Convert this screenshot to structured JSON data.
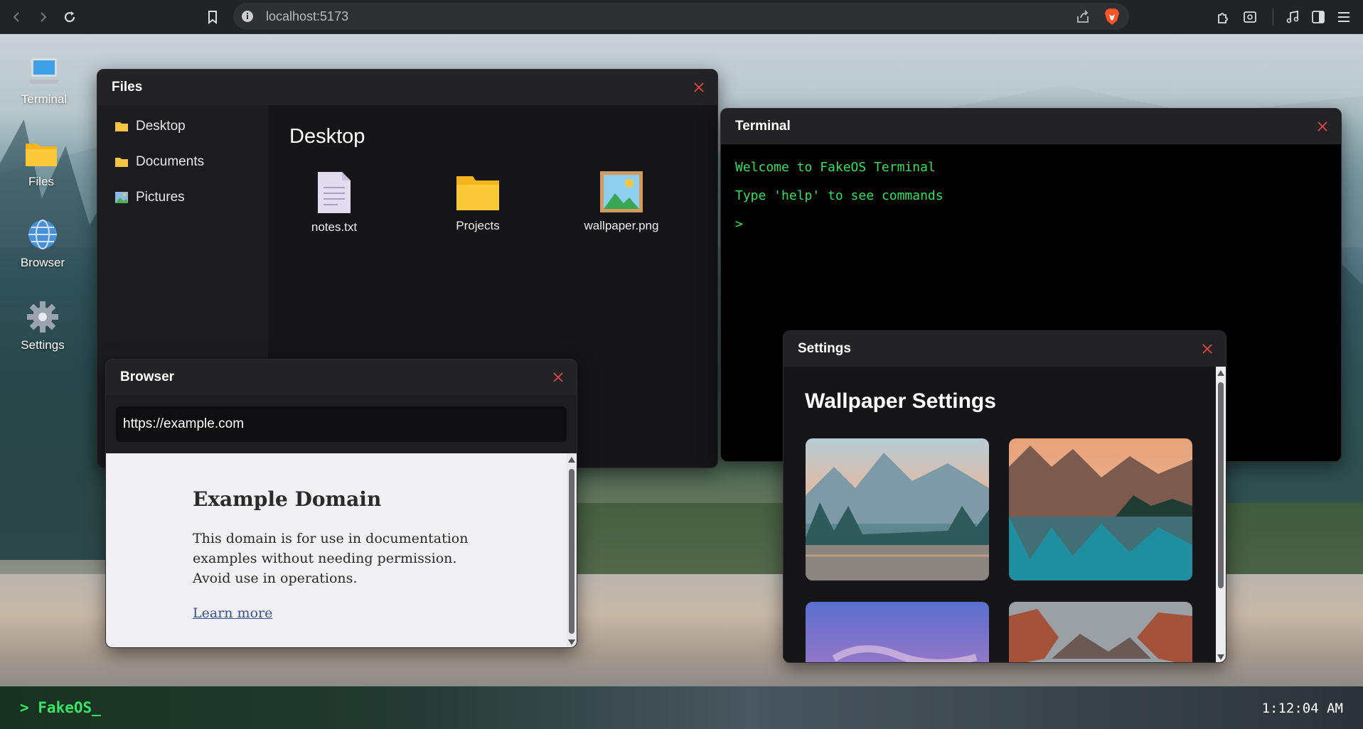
{
  "browser_chrome": {
    "url": "localhost:5173",
    "icons": [
      "back-icon",
      "forward-icon",
      "reload-icon",
      "bookmark-icon",
      "info-icon",
      "share-icon",
      "brave-icon",
      "extensions-icon",
      "screenshot-icon",
      "media-icon",
      "sidebar-icon",
      "menu-icon"
    ]
  },
  "desktop_icons": [
    {
      "label": "Terminal",
      "icon": "laptop-icon"
    },
    {
      "label": "Files",
      "icon": "folder-icon"
    },
    {
      "label": "Browser",
      "icon": "globe-icon"
    },
    {
      "label": "Settings",
      "icon": "gear-icon"
    }
  ],
  "files_window": {
    "title": "Files",
    "sidebar": [
      {
        "label": "Desktop",
        "icon": "folder-icon"
      },
      {
        "label": "Documents",
        "icon": "folder-icon"
      },
      {
        "label": "Pictures",
        "icon": "image-icon"
      }
    ],
    "heading": "Desktop",
    "items": [
      {
        "label": "notes.txt",
        "icon": "text-file-icon"
      },
      {
        "label": "Projects",
        "icon": "folder-icon"
      },
      {
        "label": "wallpaper.png",
        "icon": "image-file-icon"
      }
    ]
  },
  "terminal_window": {
    "title": "Terminal",
    "lines": [
      "Welcome to FakeOS Terminal",
      "Type 'help' to see commands",
      ">"
    ]
  },
  "browser_window": {
    "title": "Browser",
    "address": "https://example.com",
    "page": {
      "heading": "Example Domain",
      "body": "This domain is for use in documentation examples without needing permission. Avoid use in operations.",
      "link": "Learn more"
    }
  },
  "settings_window": {
    "title": "Settings",
    "heading": "Wallpaper Settings",
    "wallpapers": [
      "wallpaper-thumb-valley",
      "wallpaper-thumb-lake",
      "wallpaper-thumb-purple-sky",
      "wallpaper-thumb-red-canyon"
    ]
  },
  "taskbar": {
    "brand": "> FakeOS_",
    "clock": "1:12:04 AM"
  },
  "colors": {
    "terminal_green": "#2fe25d",
    "brand_green": "#37e46a",
    "close_red": "#e04848",
    "window_bg": "#1e1e21"
  }
}
